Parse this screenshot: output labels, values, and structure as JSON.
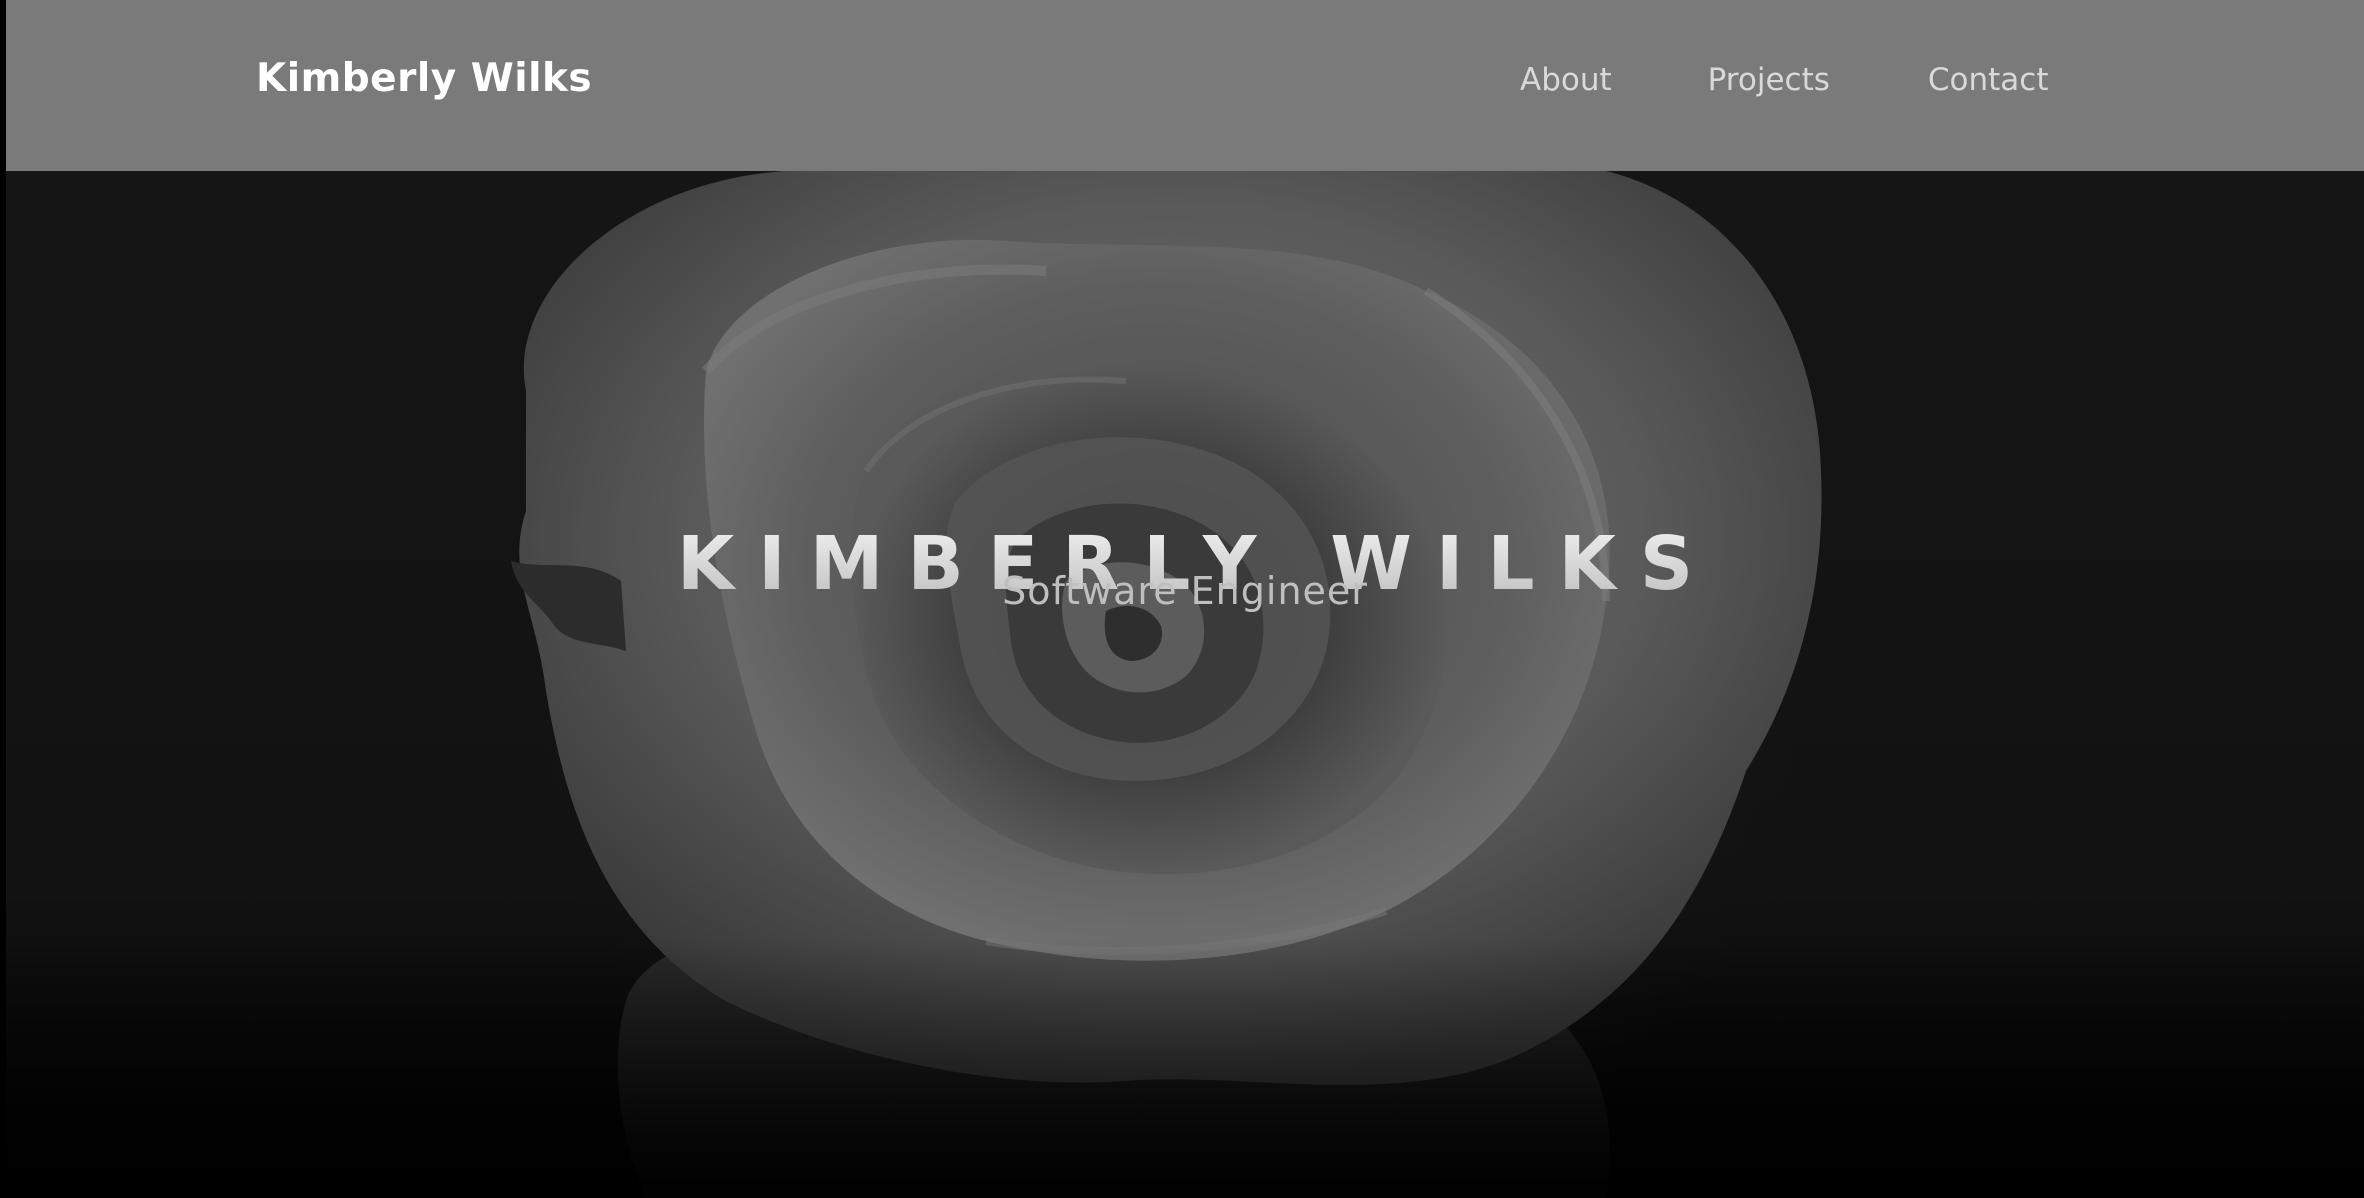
{
  "navbar": {
    "brand": "Kimberly Wilks",
    "links": [
      {
        "label": "About"
      },
      {
        "label": "Projects"
      },
      {
        "label": "Contact"
      }
    ],
    "background_color": "#7a7a7a"
  },
  "hero": {
    "title": "KIMBERLY WILKS",
    "subtitle": "Software Engineer",
    "background_image": "rose-icon"
  }
}
